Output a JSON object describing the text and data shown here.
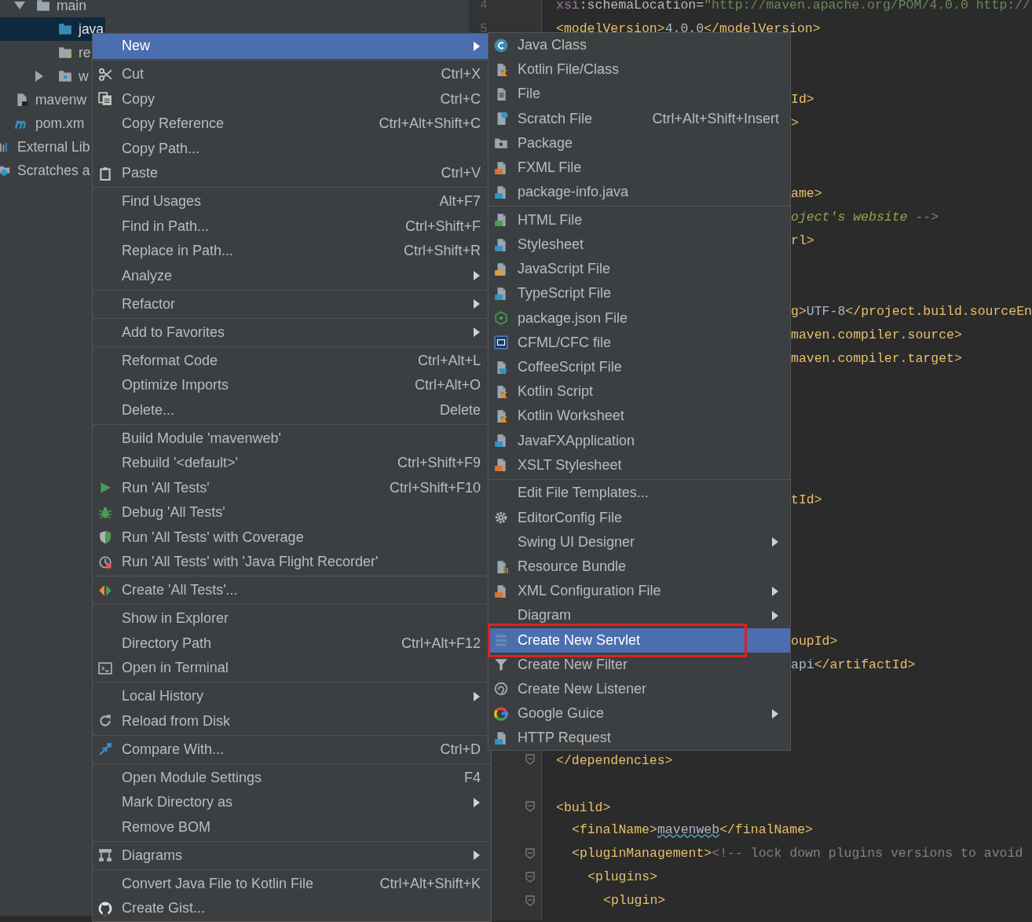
{
  "project_tree": {
    "items": [
      {
        "label": "main",
        "expanded": true,
        "selected": false,
        "children": [
          {
            "label": "java",
            "selected": true
          },
          {
            "label": "re",
            "selected": false
          },
          {
            "label": "w",
            "expanded": false,
            "selected": false
          }
        ]
      },
      {
        "label": "mavenw",
        "selected": false
      },
      {
        "label": "pom.xm",
        "selected": false
      },
      {
        "label": "External Lib",
        "selected": false
      },
      {
        "label": "Scratches a",
        "selected": false
      }
    ]
  },
  "editor": {
    "lines": [
      {
        "kind": "code",
        "number": "4",
        "segments": [
          {
            "kind": "attr",
            "text": "xsi"
          },
          {
            "kind": "plain",
            "text": ":schemaLocation="
          },
          {
            "kind": "value",
            "text": "\"http://maven.apache.org/POM/4.0.0 http://"
          }
        ]
      },
      {
        "kind": "code",
        "number": "5",
        "segments": [
          {
            "kind": "tag",
            "text": "<modelVersion>"
          },
          {
            "kind": "text",
            "text": "4.0.0"
          },
          {
            "kind": "tag",
            "text": "</modelVersion>"
          }
        ]
      },
      {
        "kind": "blank"
      },
      {
        "kind": "blank"
      },
      {
        "kind": "clipped",
        "segments": [
          {
            "kind": "tag",
            "text": "Id>"
          }
        ]
      },
      {
        "kind": "clipped",
        "segments": [
          {
            "kind": "tag",
            "text": ">"
          }
        ]
      },
      {
        "kind": "blank"
      },
      {
        "kind": "blank"
      },
      {
        "kind": "clipped",
        "segments": [
          {
            "kind": "tag",
            "text": "ame>"
          }
        ]
      },
      {
        "kind": "clipped",
        "segments": [
          {
            "kind": "doc",
            "text": "oject's website"
          },
          {
            "kind": "comment",
            "text": " -->"
          }
        ]
      },
      {
        "kind": "clipped",
        "segments": [
          {
            "kind": "tag",
            "text": "rl>"
          }
        ]
      },
      {
        "kind": "blank"
      },
      {
        "kind": "blank"
      },
      {
        "kind": "clipped",
        "segments": [
          {
            "kind": "tag",
            "text": "g>"
          },
          {
            "kind": "text",
            "text": "UTF-8"
          },
          {
            "kind": "tag",
            "text": "</project.build.sourceEn"
          }
        ]
      },
      {
        "kind": "clipped",
        "segments": [
          {
            "kind": "tag",
            "text": "maven.compiler.source>"
          }
        ]
      },
      {
        "kind": "clipped",
        "segments": [
          {
            "kind": "tag",
            "text": "maven.compiler.target>"
          }
        ]
      },
      {
        "kind": "blank"
      },
      {
        "kind": "blank"
      },
      {
        "kind": "blank"
      },
      {
        "kind": "blank"
      },
      {
        "kind": "blank"
      },
      {
        "kind": "clipped",
        "segments": [
          {
            "kind": "tag",
            "text": "tId>"
          }
        ]
      },
      {
        "kind": "blank"
      },
      {
        "kind": "blank"
      },
      {
        "kind": "blank"
      },
      {
        "kind": "blank"
      },
      {
        "kind": "blank"
      },
      {
        "kind": "clipped",
        "segments": [
          {
            "kind": "tag",
            "text": "oupId>"
          }
        ]
      },
      {
        "kind": "clipped",
        "segments": [
          {
            "kind": "text",
            "text": "api"
          },
          {
            "kind": "tag",
            "text": "</artifactId>"
          }
        ]
      },
      {
        "kind": "blank"
      },
      {
        "kind": "blank"
      },
      {
        "kind": "blank"
      },
      {
        "kind": "code",
        "fold_marker": true,
        "segments": [
          {
            "kind": "tag",
            "text": "</dependencies>"
          }
        ]
      },
      {
        "kind": "blank",
        "fold_marker": false
      },
      {
        "kind": "code",
        "fold_marker": true,
        "segments": [
          {
            "kind": "tag",
            "text": "<build>"
          }
        ],
        "children": [
          {
            "kind": "code",
            "fold_marker": false,
            "segments": [
              {
                "kind": "tag",
                "text": "<finalName>"
              },
              {
                "kind": "typo",
                "text": "mavenweb"
              },
              {
                "kind": "tag",
                "text": "</finalName>"
              }
            ]
          },
          {
            "kind": "code",
            "fold_marker": true,
            "segments": [
              {
                "kind": "tag",
                "text": "<pluginManagement>"
              },
              {
                "kind": "comment",
                "text": "<!-- lock down plugins versions to avoid"
              }
            ],
            "children": [
              {
                "kind": "code",
                "fold_marker": true,
                "segments": [
                  {
                    "kind": "tag",
                    "text": "<plugins>"
                  }
                ],
                "children": [
                  {
                    "kind": "code",
                    "fold_marker": true,
                    "segments": [
                      {
                        "kind": "tag",
                        "text": "<plugin>"
                      }
                    ]
                  }
                ]
              }
            ]
          }
        ]
      }
    ]
  },
  "context_menu": {
    "groups": [
      [
        {
          "label": "New",
          "selected": true,
          "submenu": true
        }
      ],
      [
        {
          "label": "Cut",
          "shortcut": "Ctrl+X",
          "selected": false,
          "submenu": false
        },
        {
          "label": "Copy",
          "shortcut": "Ctrl+C",
          "selected": false,
          "submenu": false
        },
        {
          "label": "Copy Reference",
          "shortcut": "Ctrl+Alt+Shift+C",
          "selected": false,
          "submenu": false
        },
        {
          "label": "Copy Path...",
          "selected": false,
          "submenu": false
        },
        {
          "label": "Paste",
          "shortcut": "Ctrl+V",
          "selected": false,
          "submenu": false
        }
      ],
      [
        {
          "label": "Find Usages",
          "shortcut": "Alt+F7",
          "selected": false,
          "submenu": false
        },
        {
          "label": "Find in Path...",
          "shortcut": "Ctrl+Shift+F",
          "selected": false,
          "submenu": false
        },
        {
          "label": "Replace in Path...",
          "shortcut": "Ctrl+Shift+R",
          "selected": false,
          "submenu": false
        },
        {
          "label": "Analyze",
          "selected": false,
          "submenu": true
        }
      ],
      [
        {
          "label": "Refactor",
          "selected": false,
          "submenu": true
        }
      ],
      [
        {
          "label": "Add to Favorites",
          "selected": false,
          "submenu": true
        }
      ],
      [
        {
          "label": "Reformat Code",
          "shortcut": "Ctrl+Alt+L",
          "selected": false,
          "submenu": false
        },
        {
          "label": "Optimize Imports",
          "shortcut": "Ctrl+Alt+O",
          "selected": false,
          "submenu": false
        },
        {
          "label": "Delete...",
          "shortcut": "Delete",
          "selected": false,
          "submenu": false
        }
      ],
      [
        {
          "label": "Build Module 'mavenweb'",
          "selected": false,
          "submenu": false
        },
        {
          "label": "Rebuild '<default>'",
          "shortcut": "Ctrl+Shift+F9",
          "selected": false,
          "submenu": false
        },
        {
          "label": "Run 'All Tests'",
          "shortcut": "Ctrl+Shift+F10",
          "selected": false,
          "submenu": false
        },
        {
          "label": "Debug 'All Tests'",
          "selected": false,
          "submenu": false
        },
        {
          "label": "Run 'All Tests' with Coverage",
          "selected": false,
          "submenu": false
        },
        {
          "label": "Run 'All Tests' with 'Java Flight Recorder'",
          "selected": false,
          "submenu": false
        }
      ],
      [
        {
          "label": "Create 'All Tests'...",
          "selected": false,
          "submenu": false
        }
      ],
      [
        {
          "label": "Show in Explorer",
          "selected": false,
          "submenu": false
        },
        {
          "label": "Directory Path",
          "shortcut": "Ctrl+Alt+F12",
          "selected": false,
          "submenu": false
        },
        {
          "label": "Open in Terminal",
          "selected": false,
          "submenu": false
        }
      ],
      [
        {
          "label": "Local History",
          "selected": false,
          "submenu": true
        },
        {
          "label": "Reload from Disk",
          "selected": false,
          "submenu": false
        }
      ],
      [
        {
          "label": "Compare With...",
          "shortcut": "Ctrl+D",
          "selected": false,
          "submenu": false
        }
      ],
      [
        {
          "label": "Open Module Settings",
          "shortcut": "F4",
          "selected": false,
          "submenu": false
        },
        {
          "label": "Mark Directory as",
          "selected": false,
          "submenu": true
        },
        {
          "label": "Remove BOM",
          "selected": false,
          "submenu": false
        }
      ],
      [
        {
          "label": "Diagrams",
          "selected": false,
          "submenu": true
        }
      ],
      [
        {
          "label": "Convert Java File to Kotlin File",
          "shortcut": "Ctrl+Alt+Shift+K",
          "selected": false,
          "submenu": false
        },
        {
          "label": "Create Gist...",
          "selected": false,
          "submenu": false
        }
      ]
    ]
  },
  "new_submenu": {
    "groups": [
      [
        {
          "label": "Java Class",
          "selected": false,
          "submenu": false,
          "annotated": false
        },
        {
          "label": "Kotlin File/Class",
          "selected": false,
          "submenu": false,
          "annotated": false
        },
        {
          "label": "File",
          "selected": false,
          "submenu": false,
          "annotated": false
        },
        {
          "label": "Scratch File",
          "shortcut": "Ctrl+Alt+Shift+Insert",
          "selected": false,
          "submenu": false,
          "annotated": false
        },
        {
          "label": "Package",
          "selected": false,
          "submenu": false,
          "annotated": false
        },
        {
          "label": "FXML File",
          "selected": false,
          "submenu": false,
          "annotated": false
        },
        {
          "label": "package-info.java",
          "selected": false,
          "submenu": false,
          "annotated": false
        }
      ],
      [
        {
          "label": "HTML File",
          "selected": false,
          "submenu": false,
          "annotated": false
        },
        {
          "label": "Stylesheet",
          "selected": false,
          "submenu": false,
          "annotated": false
        },
        {
          "label": "JavaScript File",
          "selected": false,
          "submenu": false,
          "annotated": false
        },
        {
          "label": "TypeScript File",
          "selected": false,
          "submenu": false,
          "annotated": false
        },
        {
          "label": "package.json File",
          "selected": false,
          "submenu": false,
          "annotated": false
        },
        {
          "label": "CFML/CFC file",
          "selected": false,
          "submenu": false,
          "annotated": false
        },
        {
          "label": "CoffeeScript File",
          "selected": false,
          "submenu": false,
          "annotated": false
        },
        {
          "label": "Kotlin Script",
          "selected": false,
          "submenu": false,
          "annotated": false
        },
        {
          "label": "Kotlin Worksheet",
          "selected": false,
          "submenu": false,
          "annotated": false
        },
        {
          "label": "JavaFXApplication",
          "selected": false,
          "submenu": false,
          "annotated": false
        },
        {
          "label": "XSLT Stylesheet",
          "selected": false,
          "submenu": false,
          "annotated": false
        }
      ],
      [
        {
          "label": "Edit File Templates...",
          "selected": false,
          "submenu": false,
          "annotated": false
        },
        {
          "label": "EditorConfig File",
          "selected": false,
          "submenu": false,
          "annotated": false
        },
        {
          "label": "Swing UI Designer",
          "selected": false,
          "submenu": true,
          "annotated": false
        },
        {
          "label": "Resource Bundle",
          "selected": false,
          "submenu": false,
          "annotated": false
        },
        {
          "label": "XML Configuration File",
          "selected": false,
          "submenu": true,
          "annotated": false
        },
        {
          "label": "Diagram",
          "selected": false,
          "submenu": true,
          "annotated": false
        },
        {
          "label": "Create New Servlet",
          "selected": true,
          "submenu": false,
          "annotated": true
        },
        {
          "label": "Create New Filter",
          "selected": false,
          "submenu": false,
          "annotated": false
        },
        {
          "label": "Create New Listener",
          "selected": false,
          "submenu": false,
          "annotated": false
        },
        {
          "label": "Google Guice",
          "selected": false,
          "submenu": true,
          "annotated": false
        },
        {
          "label": "HTTP Request",
          "selected": false,
          "submenu": false,
          "annotated": false
        }
      ]
    ]
  }
}
